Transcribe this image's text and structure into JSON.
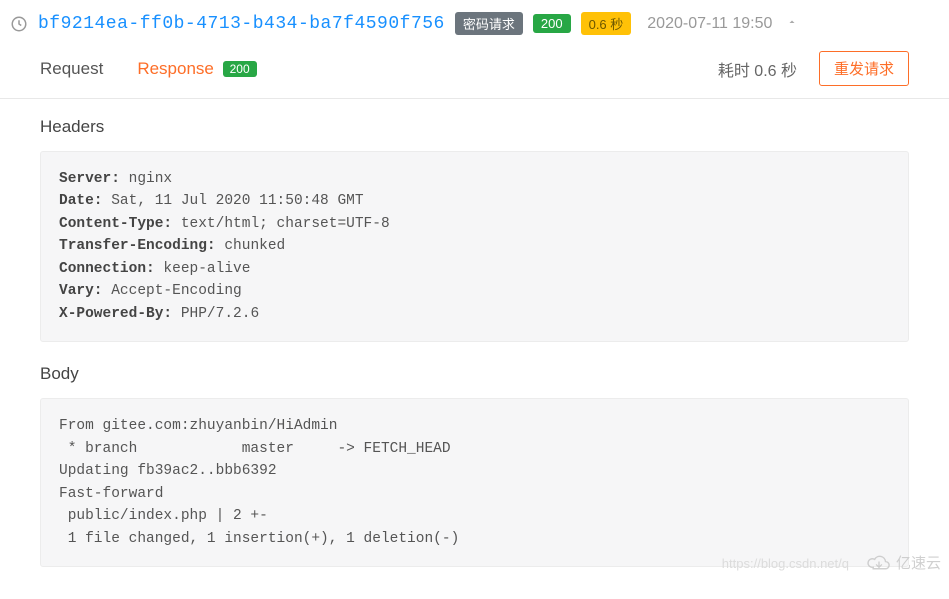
{
  "header": {
    "uuid": "bf9214ea-ff0b-4713-b434-ba7f4590f756",
    "type_badge": "密码请求",
    "status_badge": "200",
    "duration_badge": "0.6 秒",
    "timestamp": "2020-07-11 19:50"
  },
  "tabs": {
    "request_label": "Request",
    "response_label": "Response",
    "response_badge": "200"
  },
  "meta": {
    "elapsed_text": "耗时 0.6 秒",
    "resend_label": "重发请求"
  },
  "sections": {
    "headers_title": "Headers",
    "body_title": "Body"
  },
  "response_headers": [
    {
      "key": "Server:",
      "value": " nginx"
    },
    {
      "key": "Date:",
      "value": " Sat, 11 Jul 2020 11:50:48 GMT"
    },
    {
      "key": "Content-Type:",
      "value": " text/html; charset=UTF-8"
    },
    {
      "key": "Transfer-Encoding:",
      "value": " chunked"
    },
    {
      "key": "Connection:",
      "value": " keep-alive"
    },
    {
      "key": "Vary:",
      "value": " Accept-Encoding"
    },
    {
      "key": "X-Powered-By:",
      "value": " PHP/7.2.6"
    }
  ],
  "response_body": "From gitee.com:zhuyanbin/HiAdmin\n * branch            master     -> FETCH_HEAD\nUpdating fb39ac2..bbb6392\nFast-forward\n public/index.php | 2 +-\n 1 file changed, 1 insertion(+), 1 deletion(-)",
  "watermark": {
    "brand": "亿速云",
    "url": "https://blog.csdn.net/q"
  }
}
